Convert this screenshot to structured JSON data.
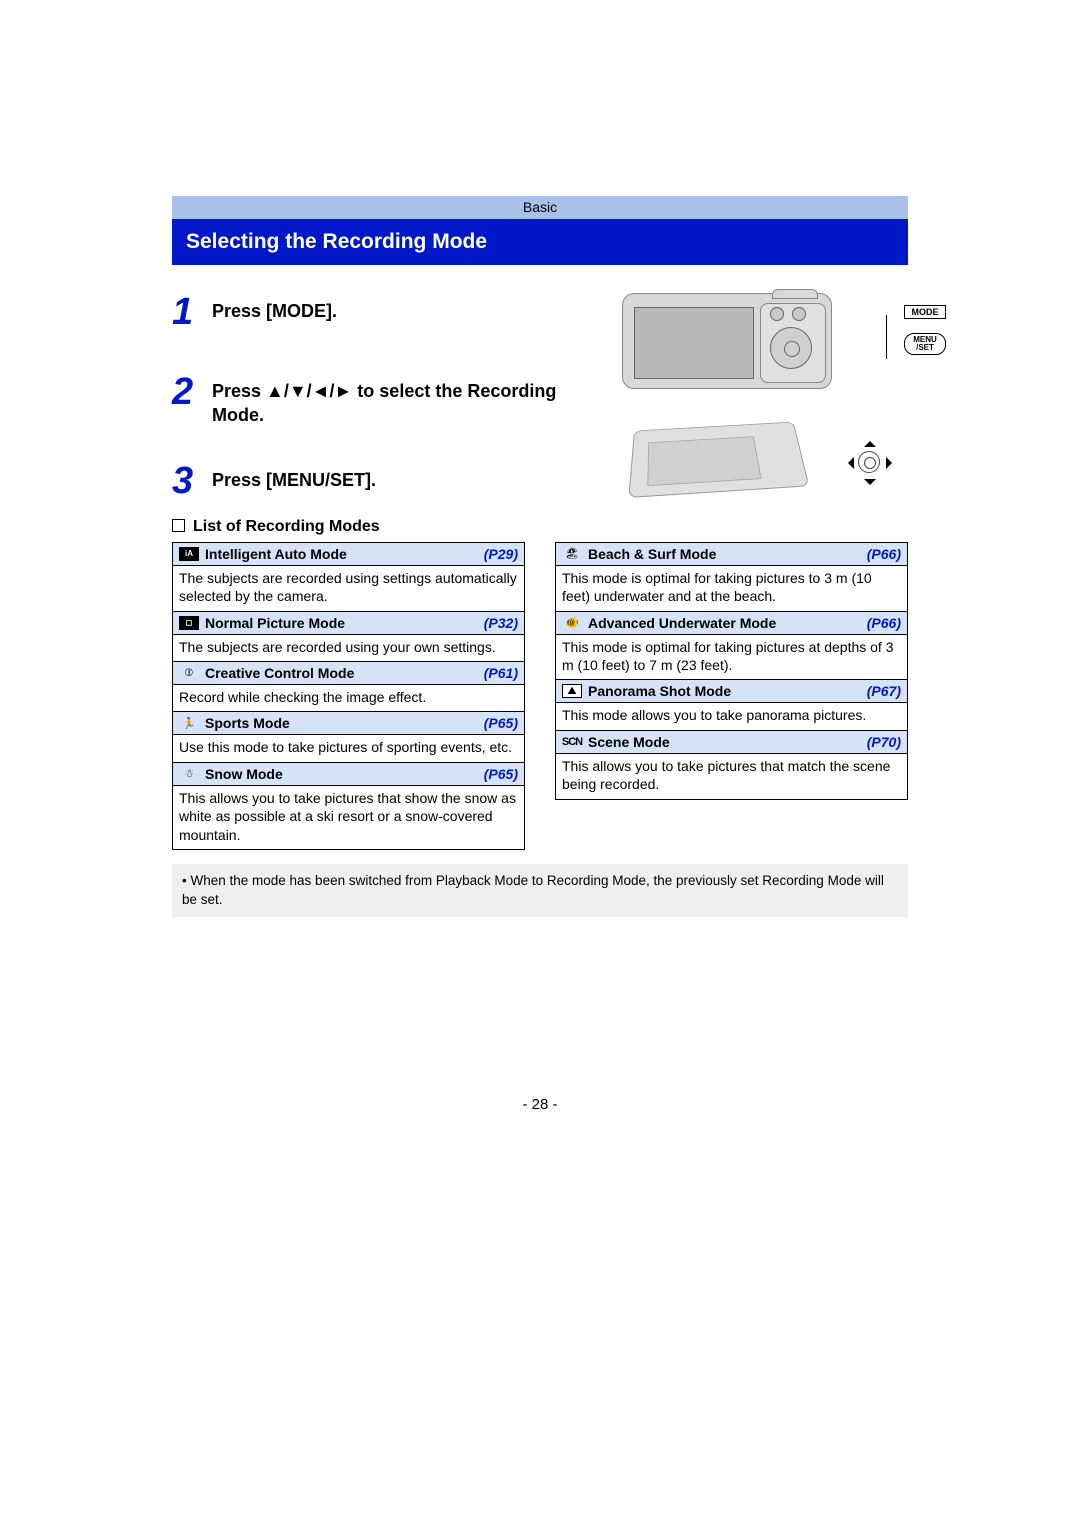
{
  "section_label": "Basic",
  "page_title": "Selecting the Recording Mode",
  "steps": [
    {
      "num": "1",
      "text": "Press [MODE]."
    },
    {
      "num": "2",
      "text": "Press ▲/▼/◄/► to select the Recording Mode."
    },
    {
      "num": "3",
      "text": "Press [MENU/SET]."
    }
  ],
  "camera_labels": {
    "mode": "MODE",
    "menu": "MENU /SET"
  },
  "list_heading": "List of Recording Modes",
  "modes_left": [
    {
      "icon": "iA",
      "title": "Intelligent Auto Mode",
      "pref": "(P29)",
      "desc": "The subjects are recorded using settings automatically selected by the camera."
    },
    {
      "icon": "cam",
      "title": "Normal Picture Mode",
      "pref": "(P32)",
      "desc": "The subjects are recorded using your own settings."
    },
    {
      "icon": "fx",
      "title": "Creative Control Mode",
      "pref": "(P61)",
      "desc": "Record while checking the image effect."
    },
    {
      "icon": "sport",
      "title": "Sports Mode",
      "pref": "(P65)",
      "desc": "Use this mode to take pictures of sporting events, etc."
    },
    {
      "icon": "snow",
      "title": "Snow Mode",
      "pref": "(P65)",
      "desc": "This allows you to take pictures that show the snow as white as possible at a ski resort or a snow-covered mountain."
    }
  ],
  "modes_right": [
    {
      "icon": "beach",
      "title": "Beach & Surf Mode",
      "pref": "(P66)",
      "desc": "This mode is optimal for taking pictures to 3 m (10 feet) underwater and at the beach."
    },
    {
      "icon": "uw",
      "title": "Advanced Underwater Mode",
      "pref": "(P66)",
      "desc": "This mode is optimal for taking pictures at depths of 3 m (10 feet) to 7 m (23 feet)."
    },
    {
      "icon": "pano",
      "title": "Panorama Shot Mode",
      "pref": "(P67)",
      "desc": "This mode allows you to take panorama pictures."
    },
    {
      "icon": "scn",
      "title": "Scene Mode",
      "pref": "(P70)",
      "desc": "This allows you to take pictures that match the scene being recorded."
    }
  ],
  "foot_note": "When the mode has been switched from Playback Mode to Recording Mode, the previously set Recording Mode will be set.",
  "page_number": "- 28 -"
}
